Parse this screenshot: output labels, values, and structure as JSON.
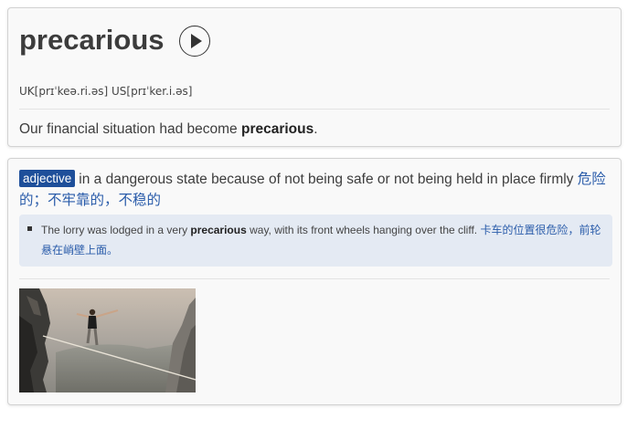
{
  "entry": {
    "word": "precarious",
    "pronunciation": {
      "uk_label": "UK",
      "uk_ipa": "[prɪˈkeə.ri.əs]",
      "us_label": "US",
      "us_ipa": "[prɪˈker.i.əs]"
    },
    "example": {
      "before": "Our financial situation had become ",
      "bold": "precarious",
      "after": "."
    }
  },
  "definition": {
    "part_of_speech": "adjective",
    "text": "in a dangerous state because of not being safe or not being held in place firmly",
    "translation": "危险的；不牢靠的，不稳的",
    "example": {
      "before": "The lorry was lodged in a very ",
      "bold": "precarious",
      "after": " way, with its front wheels hanging over the cliff.",
      "translation": "卡车的位置很危险，前轮悬在峭壁上面。"
    }
  },
  "colors": {
    "badge_bg": "#1e4f9a",
    "translation": "#2a5caa",
    "example_box_bg": "#e4eaf3",
    "card_bg": "#f9f9f9"
  },
  "icons": {
    "audio": "play-icon"
  }
}
